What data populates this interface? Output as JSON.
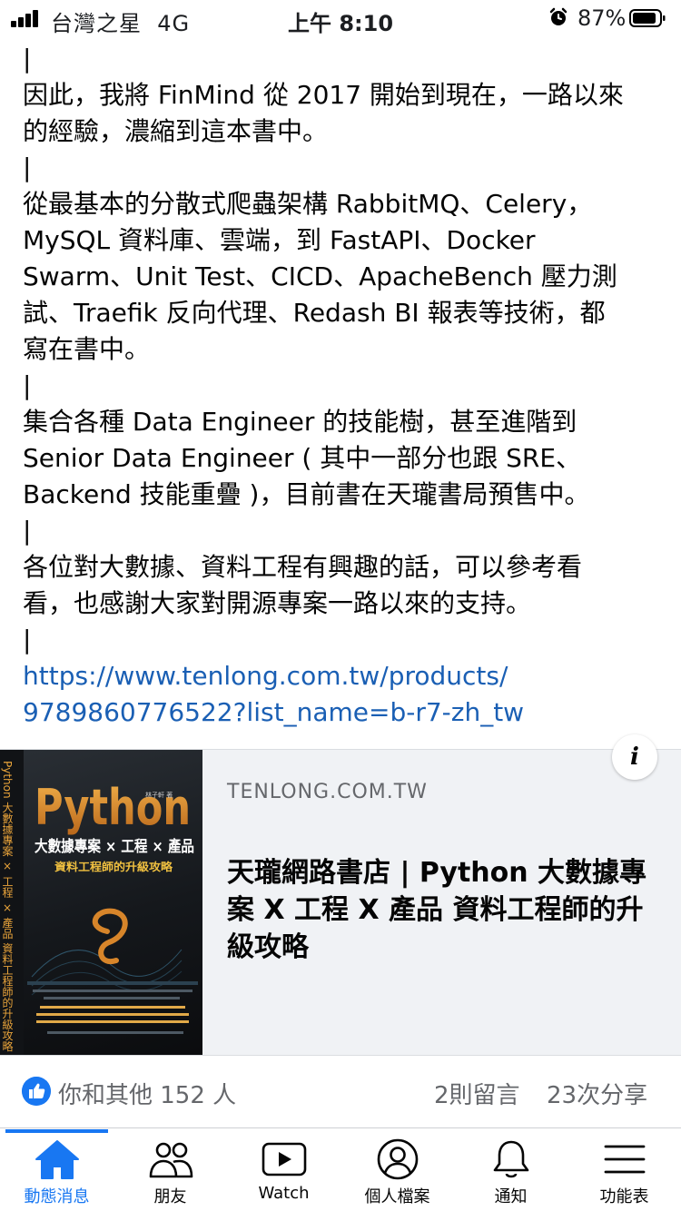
{
  "status_bar": {
    "carrier": "台灣之星",
    "network": "4G",
    "time": "上午 8:10",
    "battery": "87%"
  },
  "post": {
    "paragraphs": [
      "|",
      "因此，我將 FinMind 從 2017 開始到現在，一路以來\n的經驗，濃縮到這本書中。",
      "|",
      "從最基本的分散式爬蟲架構 RabbitMQ、Celery，\nMySQL 資料庫、雲端，到 FastAPI、Docker\nSwarm、Unit Test、CICD、ApacheBench 壓力測\n試、Traefik 反向代理、Redash BI 報表等技術，都\n寫在書中。",
      "|",
      "集合各種 Data Engineer 的技能樹，甚至進階到\nSenior Data Engineer ( 其中一部分也跟 SRE、\nBackend 技能重疊 )，目前書在天瓏書局預售中。",
      "|",
      "各位對大數據、資料工程有興趣的話，可以參考看\n看，也感謝大家對開源專案一路以來的支持。",
      "|"
    ],
    "link_text": "https://www.tenlong.com.tw/products/\n9789860776522?list_name=b-r7-zh_tw"
  },
  "link_card": {
    "domain": "TENLONG.COM.TW",
    "title": "天瓏網路書店 | Python 大數據專案 X 工程 X 產品 資料工程師的升級攻略",
    "info_icon": "i",
    "cover": {
      "python": "Python",
      "subtitle": "大數據專案 × 工程 × 產品",
      "tagline": "資料工程師的升級攻略",
      "spine": "Python 大數據專案 × 工程 × 產品 資料工程師的升級攻略",
      "author": "林子軒 著"
    }
  },
  "reactions": {
    "likes": "你和其他 152 人",
    "comments": "2則留言",
    "shares": "23次分享"
  },
  "tabs": [
    {
      "label": "動態消息",
      "icon": "home-icon",
      "active": true
    },
    {
      "label": "朋友",
      "icon": "friends-icon",
      "active": false
    },
    {
      "label": "Watch",
      "icon": "watch-icon",
      "active": false
    },
    {
      "label": "個人檔案",
      "icon": "profile-icon",
      "active": false
    },
    {
      "label": "通知",
      "icon": "bell-icon",
      "active": false
    },
    {
      "label": "功能表",
      "icon": "menu-icon",
      "active": false
    }
  ],
  "colors": {
    "accent": "#1877f2",
    "link": "#1a5fb4",
    "card_bg": "#f0f2f5",
    "secondary_text": "#65676b"
  }
}
